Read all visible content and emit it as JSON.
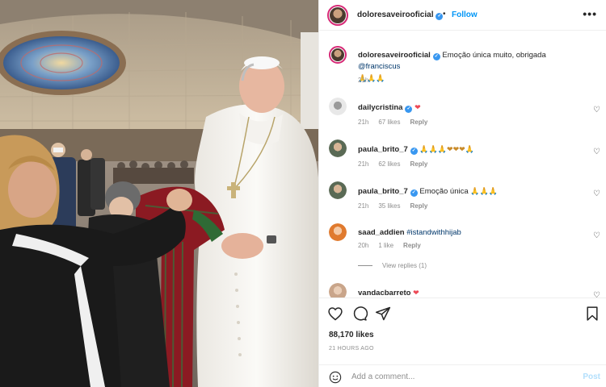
{
  "post": {
    "author": "doloresaveirooficial",
    "follow_label": "Follow",
    "separator": "•",
    "more_label": "•••",
    "verified_mark": "✓",
    "caption_text": "Emoção única muito, obrigada ",
    "caption_mention": "@franciscus",
    "caption_emoji": "🙏🙏🙏",
    "caption_time": "21h",
    "likes": "88,170 likes",
    "posted_ago": "21 HOURS AGO",
    "add_comment_placeholder": "Add a comment...",
    "post_label": "Post"
  },
  "comments": [
    {
      "user": "dailycristina",
      "text": "",
      "emoji": "❤",
      "time": "21h",
      "likes": "67 likes",
      "reply": "Reply",
      "avatar_color": "#e8e8e8"
    },
    {
      "user": "paula_brito_7",
      "text": "",
      "emoji": "🙏🙏🙏❤❤❤🙏",
      "time": "21h",
      "likes": "62 likes",
      "reply": "Reply",
      "avatar_color": "#5a6a55"
    },
    {
      "user": "paula_brito_7",
      "text": "Emoção única ",
      "emoji": "🙏🙏🙏",
      "time": "21h",
      "likes": "35 likes",
      "reply": "Reply",
      "avatar_color": "#5a6a55"
    },
    {
      "user": "saad_addien",
      "text": "",
      "hashtag": "#istandwithhijab",
      "time": "20h",
      "likes": "1 like",
      "reply": "Reply",
      "view_replies": "View replies (1)",
      "avatar_color": "#e07a2e"
    },
    {
      "user": "vandacbarreto",
      "text": "",
      "emoji": "❤",
      "avatar_color": "#c9a58a"
    }
  ],
  "icons": {
    "heart": "heart-icon",
    "comment": "comment-icon",
    "share": "share-icon",
    "save": "bookmark-icon",
    "emoji": "emoji-icon",
    "more": "more-icon"
  },
  "colors": {
    "link_blue": "#0095f6",
    "verified_blue": "#3897f0",
    "heart_red": "#ed4956",
    "muted": "#8e8e8e",
    "post_disabled": "#b2dffc"
  }
}
